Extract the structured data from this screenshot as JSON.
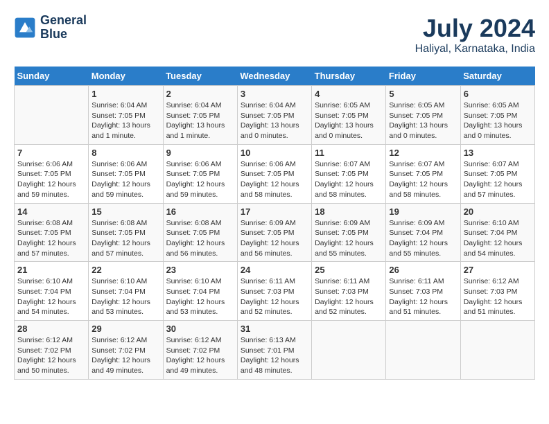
{
  "logo": {
    "line1": "General",
    "line2": "Blue"
  },
  "title": "July 2024",
  "subtitle": "Haliyal, Karnataka, India",
  "days_header": [
    "Sunday",
    "Monday",
    "Tuesday",
    "Wednesday",
    "Thursday",
    "Friday",
    "Saturday"
  ],
  "weeks": [
    [
      {
        "day": "",
        "info": ""
      },
      {
        "day": "1",
        "info": "Sunrise: 6:04 AM\nSunset: 7:05 PM\nDaylight: 13 hours\nand 1 minute."
      },
      {
        "day": "2",
        "info": "Sunrise: 6:04 AM\nSunset: 7:05 PM\nDaylight: 13 hours\nand 1 minute."
      },
      {
        "day": "3",
        "info": "Sunrise: 6:04 AM\nSunset: 7:05 PM\nDaylight: 13 hours\nand 0 minutes."
      },
      {
        "day": "4",
        "info": "Sunrise: 6:05 AM\nSunset: 7:05 PM\nDaylight: 13 hours\nand 0 minutes."
      },
      {
        "day": "5",
        "info": "Sunrise: 6:05 AM\nSunset: 7:05 PM\nDaylight: 13 hours\nand 0 minutes."
      },
      {
        "day": "6",
        "info": "Sunrise: 6:05 AM\nSunset: 7:05 PM\nDaylight: 13 hours\nand 0 minutes."
      }
    ],
    [
      {
        "day": "7",
        "info": "Sunrise: 6:06 AM\nSunset: 7:05 PM\nDaylight: 12 hours\nand 59 minutes."
      },
      {
        "day": "8",
        "info": "Sunrise: 6:06 AM\nSunset: 7:05 PM\nDaylight: 12 hours\nand 59 minutes."
      },
      {
        "day": "9",
        "info": "Sunrise: 6:06 AM\nSunset: 7:05 PM\nDaylight: 12 hours\nand 59 minutes."
      },
      {
        "day": "10",
        "info": "Sunrise: 6:06 AM\nSunset: 7:05 PM\nDaylight: 12 hours\nand 58 minutes."
      },
      {
        "day": "11",
        "info": "Sunrise: 6:07 AM\nSunset: 7:05 PM\nDaylight: 12 hours\nand 58 minutes."
      },
      {
        "day": "12",
        "info": "Sunrise: 6:07 AM\nSunset: 7:05 PM\nDaylight: 12 hours\nand 58 minutes."
      },
      {
        "day": "13",
        "info": "Sunrise: 6:07 AM\nSunset: 7:05 PM\nDaylight: 12 hours\nand 57 minutes."
      }
    ],
    [
      {
        "day": "14",
        "info": "Sunrise: 6:08 AM\nSunset: 7:05 PM\nDaylight: 12 hours\nand 57 minutes."
      },
      {
        "day": "15",
        "info": "Sunrise: 6:08 AM\nSunset: 7:05 PM\nDaylight: 12 hours\nand 57 minutes."
      },
      {
        "day": "16",
        "info": "Sunrise: 6:08 AM\nSunset: 7:05 PM\nDaylight: 12 hours\nand 56 minutes."
      },
      {
        "day": "17",
        "info": "Sunrise: 6:09 AM\nSunset: 7:05 PM\nDaylight: 12 hours\nand 56 minutes."
      },
      {
        "day": "18",
        "info": "Sunrise: 6:09 AM\nSunset: 7:05 PM\nDaylight: 12 hours\nand 55 minutes."
      },
      {
        "day": "19",
        "info": "Sunrise: 6:09 AM\nSunset: 7:04 PM\nDaylight: 12 hours\nand 55 minutes."
      },
      {
        "day": "20",
        "info": "Sunrise: 6:10 AM\nSunset: 7:04 PM\nDaylight: 12 hours\nand 54 minutes."
      }
    ],
    [
      {
        "day": "21",
        "info": "Sunrise: 6:10 AM\nSunset: 7:04 PM\nDaylight: 12 hours\nand 54 minutes."
      },
      {
        "day": "22",
        "info": "Sunrise: 6:10 AM\nSunset: 7:04 PM\nDaylight: 12 hours\nand 53 minutes."
      },
      {
        "day": "23",
        "info": "Sunrise: 6:10 AM\nSunset: 7:04 PM\nDaylight: 12 hours\nand 53 minutes."
      },
      {
        "day": "24",
        "info": "Sunrise: 6:11 AM\nSunset: 7:03 PM\nDaylight: 12 hours\nand 52 minutes."
      },
      {
        "day": "25",
        "info": "Sunrise: 6:11 AM\nSunset: 7:03 PM\nDaylight: 12 hours\nand 52 minutes."
      },
      {
        "day": "26",
        "info": "Sunrise: 6:11 AM\nSunset: 7:03 PM\nDaylight: 12 hours\nand 51 minutes."
      },
      {
        "day": "27",
        "info": "Sunrise: 6:12 AM\nSunset: 7:03 PM\nDaylight: 12 hours\nand 51 minutes."
      }
    ],
    [
      {
        "day": "28",
        "info": "Sunrise: 6:12 AM\nSunset: 7:02 PM\nDaylight: 12 hours\nand 50 minutes."
      },
      {
        "day": "29",
        "info": "Sunrise: 6:12 AM\nSunset: 7:02 PM\nDaylight: 12 hours\nand 49 minutes."
      },
      {
        "day": "30",
        "info": "Sunrise: 6:12 AM\nSunset: 7:02 PM\nDaylight: 12 hours\nand 49 minutes."
      },
      {
        "day": "31",
        "info": "Sunrise: 6:13 AM\nSunset: 7:01 PM\nDaylight: 12 hours\nand 48 minutes."
      },
      {
        "day": "",
        "info": ""
      },
      {
        "day": "",
        "info": ""
      },
      {
        "day": "",
        "info": ""
      }
    ]
  ]
}
